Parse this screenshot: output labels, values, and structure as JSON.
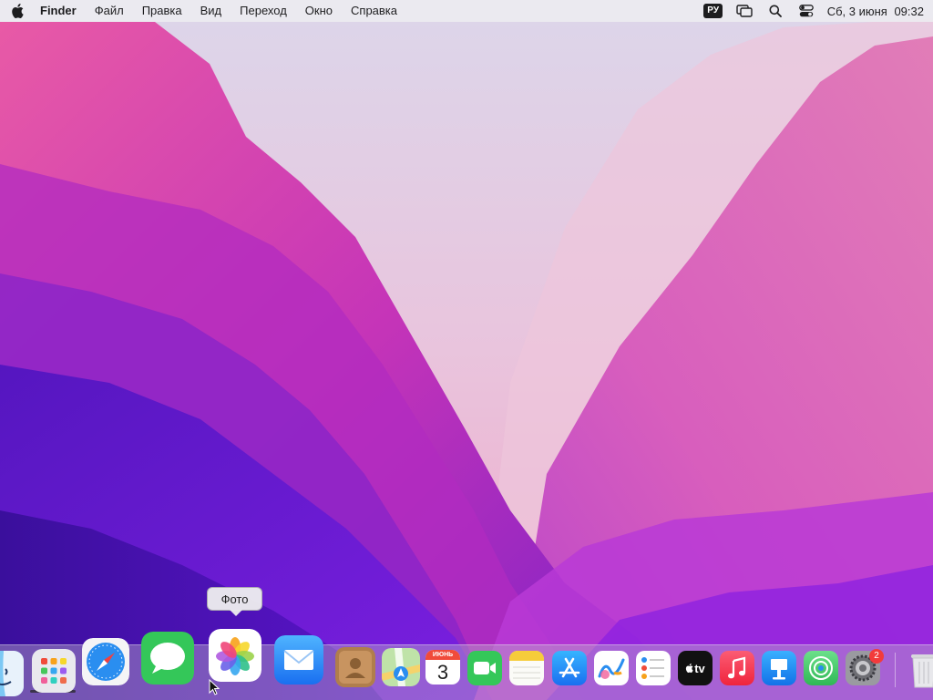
{
  "menubar": {
    "apple_icon": "apple-logo-icon",
    "app_name": "Finder",
    "menus": [
      "Файл",
      "Правка",
      "Вид",
      "Переход",
      "Окно",
      "Справка"
    ],
    "input_language": "РУ",
    "status_icons": [
      "window-switcher-icon",
      "search-icon",
      "control-center-icon"
    ],
    "date": "Сб, 3 июня",
    "time": "09:32"
  },
  "tooltip": {
    "text": "Фото"
  },
  "dock": {
    "items": [
      {
        "name": "finder",
        "icon": "finder-icon",
        "running": true
      },
      {
        "name": "launchpad",
        "icon": "launchpad-icon"
      },
      {
        "name": "safari",
        "icon": "safari-icon"
      },
      {
        "name": "messages",
        "icon": "messages-icon"
      },
      {
        "name": "photos",
        "icon": "photos-icon",
        "hovered": true
      },
      {
        "name": "mail",
        "icon": "mail-icon"
      },
      {
        "name": "contacts",
        "icon": "contacts-icon"
      },
      {
        "name": "maps",
        "icon": "maps-icon"
      },
      {
        "name": "calendar",
        "icon": "calendar-icon",
        "month": "ИЮНЬ",
        "day": "3"
      },
      {
        "name": "facetime",
        "icon": "facetime-icon"
      },
      {
        "name": "notes",
        "icon": "notes-icon"
      },
      {
        "name": "app-store",
        "icon": "app-store-icon"
      },
      {
        "name": "freeform",
        "icon": "freeform-icon"
      },
      {
        "name": "reminders",
        "icon": "reminders-icon"
      },
      {
        "name": "apple-tv",
        "icon": "apple-tv-icon",
        "label": "tv"
      },
      {
        "name": "music",
        "icon": "music-icon"
      },
      {
        "name": "keynote",
        "icon": "keynote-icon"
      },
      {
        "name": "find-my",
        "icon": "find-my-icon"
      },
      {
        "name": "system-settings",
        "icon": "settings-icon",
        "badge": "2"
      },
      {
        "name": "trash",
        "icon": "trash-icon"
      }
    ]
  },
  "colors": {
    "menubar_bg": "#ececf0",
    "wallpaper_top": "#d9cde6",
    "wallpaper_pink": "#d43cb4",
    "wallpaper_purple": "#5a16c8",
    "badge_red": "#f23b3b"
  }
}
